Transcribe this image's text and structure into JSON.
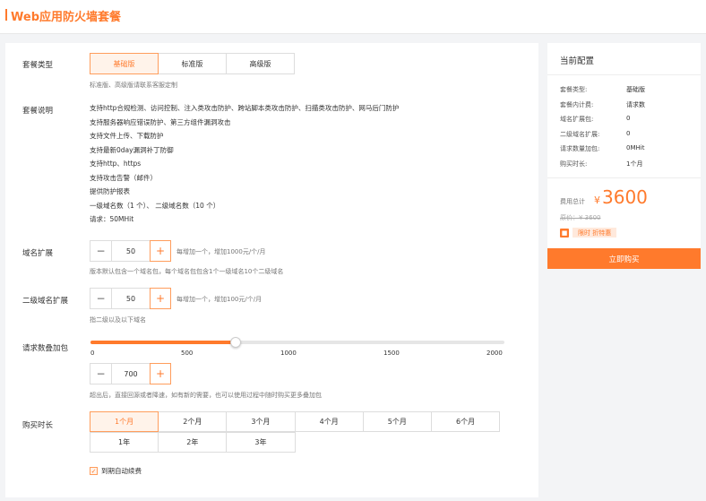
{
  "header": {
    "title": "Web应用防火墙套餐"
  },
  "package": {
    "label": "套餐类型",
    "options": [
      "基础版",
      "标准版",
      "高级版"
    ],
    "selected": 0,
    "note": "标准版、高级版请联系客服定制"
  },
  "description": {
    "label": "套餐说明",
    "lines": [
      "支持http合规检测、访问控制、注入类攻击防护、跨站脚本类攻击防护、扫描类攻击防护、网马后门防护",
      "支持服务器响应错误防护、第三方组件漏洞攻击",
      "支持文件上传、下载防护",
      "支持最新0day漏洞补丁防御",
      "支持http、https",
      "支持攻击告警（邮件）",
      "提供防护报表",
      "一级域名数（1 个）、 二级域名数（10 个）",
      "请求：50MHit"
    ]
  },
  "domain_ext": {
    "label": "域名扩展",
    "value": "50",
    "hint": "每增加一个，增加1000元/个/月",
    "note": "版本默认包含一个域名包，每个域名包包含1个一级域名10个二级域名"
  },
  "subdomain_ext": {
    "label": "二级域名扩展",
    "value": "50",
    "hint": "每增加一个，增加100元/个/月",
    "note": "指二级以及以下域名"
  },
  "request_pack": {
    "label": "请求数叠加包",
    "slider_min": 0,
    "slider_max": 2000,
    "slider_value": 700,
    "ticks": [
      "0",
      "500",
      "1000",
      "1500",
      "2000"
    ],
    "value": "700",
    "note": "超出后，直接回源或者降速，如有新的需要，也可以使用过程中随时购买更多叠加包"
  },
  "duration": {
    "label": "购买时长",
    "row1": [
      "1个月",
      "2个月",
      "3个月",
      "4个月",
      "5个月",
      "6个月"
    ],
    "row2": [
      "1年",
      "2年",
      "3年"
    ],
    "selected": "1个月"
  },
  "auto_renew": {
    "label": "到期自动续费",
    "checked": true
  },
  "summary": {
    "title": "当前配置",
    "rows": [
      {
        "k": "套餐类型:",
        "v": "基础版"
      },
      {
        "k": "套餐内计费:",
        "v": "请求数"
      },
      {
        "k": "域名扩展包:",
        "v": "0"
      },
      {
        "k": "二级域名扩展:",
        "v": "0"
      },
      {
        "k": "请求数量加包:",
        "v": "0MHit"
      },
      {
        "k": "购买时长:",
        "v": "1个月"
      }
    ],
    "total_label": "费用总计",
    "currency": "¥",
    "price": "3600",
    "original": "原价：¥ 3600",
    "promo": "限时 折特惠",
    "buy": "立即购买"
  },
  "colors": {
    "accent": "#ff7a2c",
    "accent_bg": "#fff3ea"
  }
}
